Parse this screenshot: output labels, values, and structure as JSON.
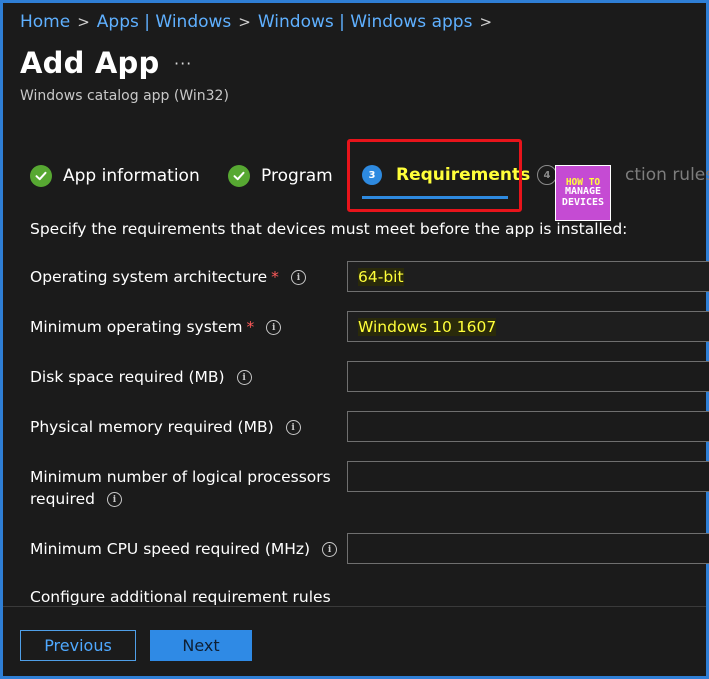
{
  "breadcrumb": [
    "Home",
    "Apps | Windows",
    "Windows | Windows apps"
  ],
  "page": {
    "title": "Add App",
    "more_label": "···",
    "subtitle": "Windows catalog app (Win32)"
  },
  "steps": [
    {
      "label": "App information",
      "status": "completed"
    },
    {
      "label": "Program",
      "status": "completed"
    },
    {
      "number": "3",
      "label": "Requirements",
      "status": "active"
    },
    {
      "number": "4",
      "label": "Detection rules",
      "visible_label": "ction rules",
      "status": "pending"
    }
  ],
  "logo": {
    "line1": "HOW TO",
    "line2": "MANAGE",
    "line3": "DEVICES"
  },
  "description": "Specify the requirements that devices must meet before the app is installed:",
  "fields": {
    "arch": {
      "label": "Operating system architecture",
      "required": true,
      "value": "64-bit"
    },
    "minos": {
      "label": "Minimum operating system",
      "required": true,
      "value": "Windows 10 1607"
    },
    "disk": {
      "label": "Disk space required (MB)",
      "required": false,
      "value": ""
    },
    "memory": {
      "label": "Physical memory required (MB)",
      "required": false,
      "value": ""
    },
    "processors": {
      "label_line1": "Minimum number of logical processors",
      "label_line2": "required",
      "required": false,
      "value": ""
    },
    "cpu": {
      "label": "Minimum CPU speed required (MHz)",
      "required": false,
      "value": ""
    }
  },
  "additional_rules_label": "Configure additional requirement rules",
  "buttons": {
    "previous": "Previous",
    "next": "Next"
  },
  "colors": {
    "accent": "#2f8ae5",
    "highlight_text": "#ffff3a",
    "required_star": "#ff5a5a",
    "success": "#57a832",
    "callout_border": "#e8141b"
  },
  "icons": {
    "completed_step": "check-icon",
    "info": "info-icon",
    "chevron": "chevron-right-icon"
  }
}
